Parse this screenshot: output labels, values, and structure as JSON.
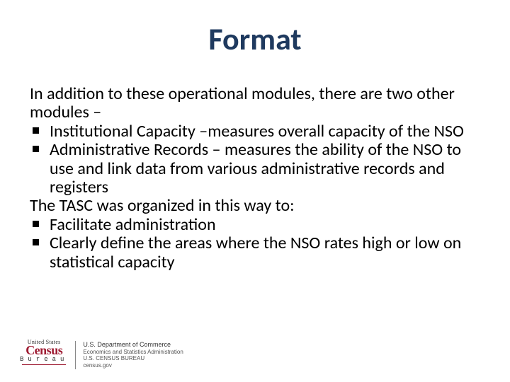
{
  "title": "Format",
  "body": {
    "intro": "In addition to these operational modules, there are two other modules –",
    "bullets1": [
      "Institutional Capacity –measures overall capacity of the NSO",
      "Administrative Records – measures the ability of the NSO to use and link data from various administrative records and registers"
    ],
    "mid": "The TASC was organized in this way to:",
    "bullets2": [
      "Facilitate administration",
      "Clearly define the areas where the NSO rates high or low on statistical capacity"
    ]
  },
  "footer": {
    "us": "United States",
    "census": "Census",
    "bureau": "Bureau",
    "dept1": "U.S. Department of Commerce",
    "dept2": "Economics and Statistics Administration",
    "dept3": "U.S. CENSUS BUREAU",
    "dept4": "census.gov"
  }
}
